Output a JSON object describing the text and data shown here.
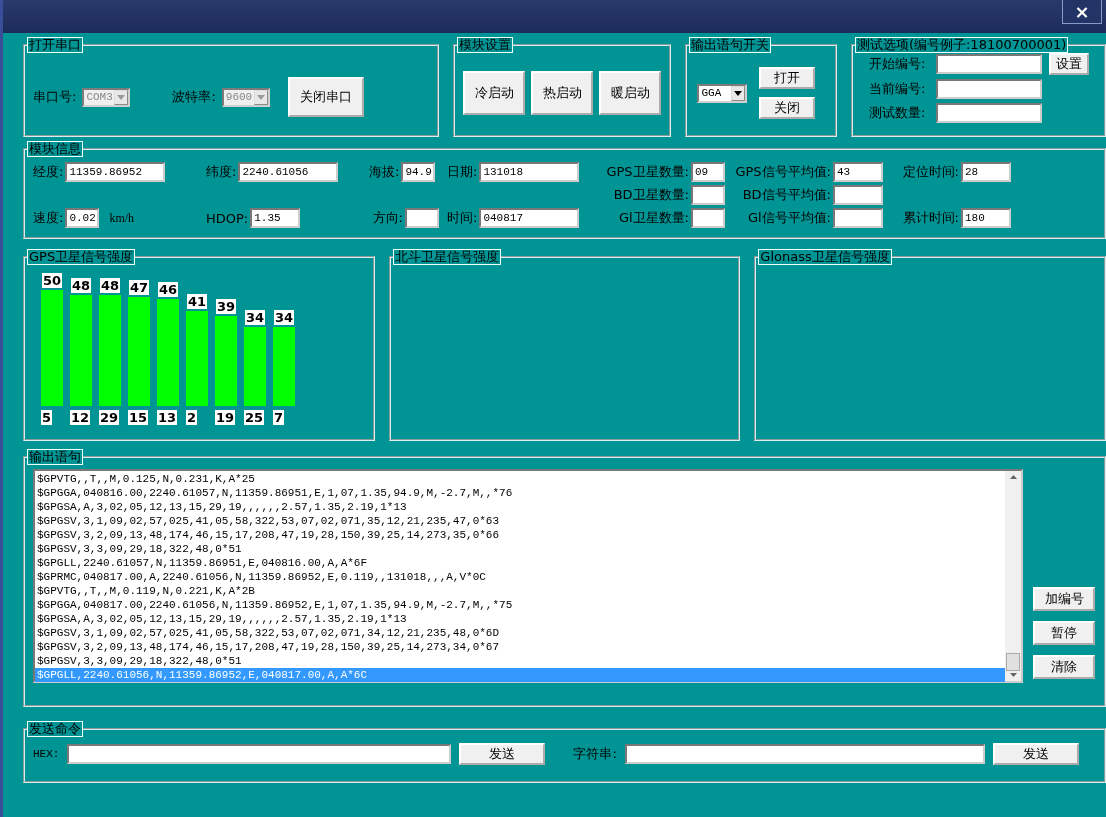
{
  "window": {
    "close": "×"
  },
  "serial": {
    "legend": "打开串口",
    "port_label": "串口号:",
    "port": {
      "value": "COM3",
      "disabled": true
    },
    "baud_label": "波特率:",
    "baud": {
      "value": "9600",
      "disabled": true
    },
    "button": "关闭串口"
  },
  "module_settings": {
    "legend": "模块设置",
    "buttons": [
      "冷启动",
      "热启动",
      "暖启动"
    ]
  },
  "output_switch": {
    "legend": "输出语句开关",
    "sentence": {
      "value": "GGA",
      "disabled": false
    },
    "buttons": [
      "打开",
      "关闭"
    ]
  },
  "test_options": {
    "legend": "测试选项(编号例子:18100700001)",
    "fields": [
      {
        "label": "开始编号:"
      },
      {
        "label": "当前编号:"
      },
      {
        "label": "测试数量:"
      }
    ],
    "button": "设置"
  },
  "module_info": {
    "legend": "模块信息",
    "fields": [
      {
        "label": "经度:",
        "value": "11359.86952"
      },
      {
        "label": "纬度:",
        "value": "2240.61056"
      },
      {
        "label": "海拔:",
        "value": "94.9"
      },
      {
        "label": "日期:",
        "value": "131018"
      },
      {
        "label": "GPS卫星数量:",
        "value": "09"
      },
      {
        "label": "GPS信号平均值:",
        "value": "43"
      },
      {
        "label": "定位时间:",
        "value": "28"
      },
      {
        "label": "BD卫星数量:"
      },
      {
        "label": "BD信号平均值:"
      },
      {
        "label": "速度:",
        "value": "0.02",
        "unit": "km/h"
      },
      {
        "label": "HDOP:",
        "value": "1.35"
      },
      {
        "label": "方向:"
      },
      {
        "label": "时间:",
        "value": "040817"
      },
      {
        "label": "Gl卫星数量:"
      },
      {
        "label": "Gl信号平均值:"
      },
      {
        "label": "累计时间:",
        "value": "180"
      }
    ]
  },
  "signal_panels": [
    {
      "legend": "GPS卫星信号强度",
      "chart_data": {
        "type": "bar",
        "categories": [
          "5",
          "12",
          "29",
          "15",
          "13",
          "2",
          "19",
          "25",
          "7"
        ],
        "values": [
          50,
          48,
          48,
          47,
          46,
          41,
          39,
          34,
          34
        ],
        "data_labels": true
      }
    },
    {
      "legend": "北斗卫星信号强度"
    },
    {
      "legend": "Glonass卫星信号强度"
    }
  ],
  "output": {
    "legend": "输出语句",
    "lines": [
      {
        "text": "$GPVTG,,T,,M,0.125,N,0.231,K,A*25",
        "selected": false
      },
      {
        "text": "$GPGGA,040816.00,2240.61057,N,11359.86951,E,1,07,1.35,94.9,M,-2.7,M,,*76",
        "selected": false
      },
      {
        "text": "$GPGSA,A,3,02,05,12,13,15,29,19,,,,,,2.57,1.35,2.19,1*13",
        "selected": false
      },
      {
        "text": "$GPGSV,3,1,09,02,57,025,41,05,58,322,53,07,02,071,35,12,21,235,47,0*63",
        "selected": false
      },
      {
        "text": "$GPGSV,3,2,09,13,48,174,46,15,17,208,47,19,28,150,39,25,14,273,35,0*66",
        "selected": false
      },
      {
        "text": "$GPGSV,3,3,09,29,18,322,48,0*51",
        "selected": false
      },
      {
        "text": "$GPGLL,2240.61057,N,11359.86951,E,040816.00,A,A*6F",
        "selected": false
      },
      {
        "text": "$GPRMC,040817.00,A,2240.61056,N,11359.86952,E,0.119,,131018,,,A,V*0C",
        "selected": false
      },
      {
        "text": "$GPVTG,,T,,M,0.119,N,0.221,K,A*2B",
        "selected": false
      },
      {
        "text": "$GPGGA,040817.00,2240.61056,N,11359.86952,E,1,07,1.35,94.9,M,-2.7,M,,*75",
        "selected": false
      },
      {
        "text": "$GPGSA,A,3,02,05,12,13,15,29,19,,,,,,2.57,1.35,2.19,1*13",
        "selected": false
      },
      {
        "text": "$GPGSV,3,1,09,02,57,025,41,05,58,322,53,07,02,071,34,12,21,235,48,0*6D",
        "selected": false
      },
      {
        "text": "$GPGSV,3,2,09,13,48,174,46,15,17,208,47,19,28,150,39,25,14,273,34,0*67",
        "selected": false
      },
      {
        "text": "$GPGSV,3,3,09,29,18,322,48,0*51",
        "selected": false
      },
      {
        "text": "$GPGLL,2240.61056,N,11359.86952,E,040817.00,A,A*6C",
        "selected": true
      }
    ],
    "buttons": [
      "加编号",
      "暂停",
      "清除"
    ]
  },
  "send": {
    "legend": "发送命令",
    "hex_label": "HEX:",
    "hex_button": "发送",
    "string_label": "字符串:",
    "string_button": "发送"
  }
}
